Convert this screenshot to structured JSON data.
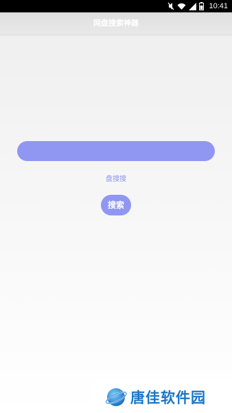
{
  "status_bar": {
    "time": "10:41"
  },
  "app_bar": {
    "title": "网盘搜索神器"
  },
  "search": {
    "value": "",
    "placeholder": ""
  },
  "source_link": {
    "label": "盘搜搜"
  },
  "search_button": {
    "label": "搜索"
  },
  "watermark": {
    "text": "唐佳软件园"
  },
  "colors": {
    "accent": "#8f97f2",
    "watermark": "#1a76c4"
  }
}
